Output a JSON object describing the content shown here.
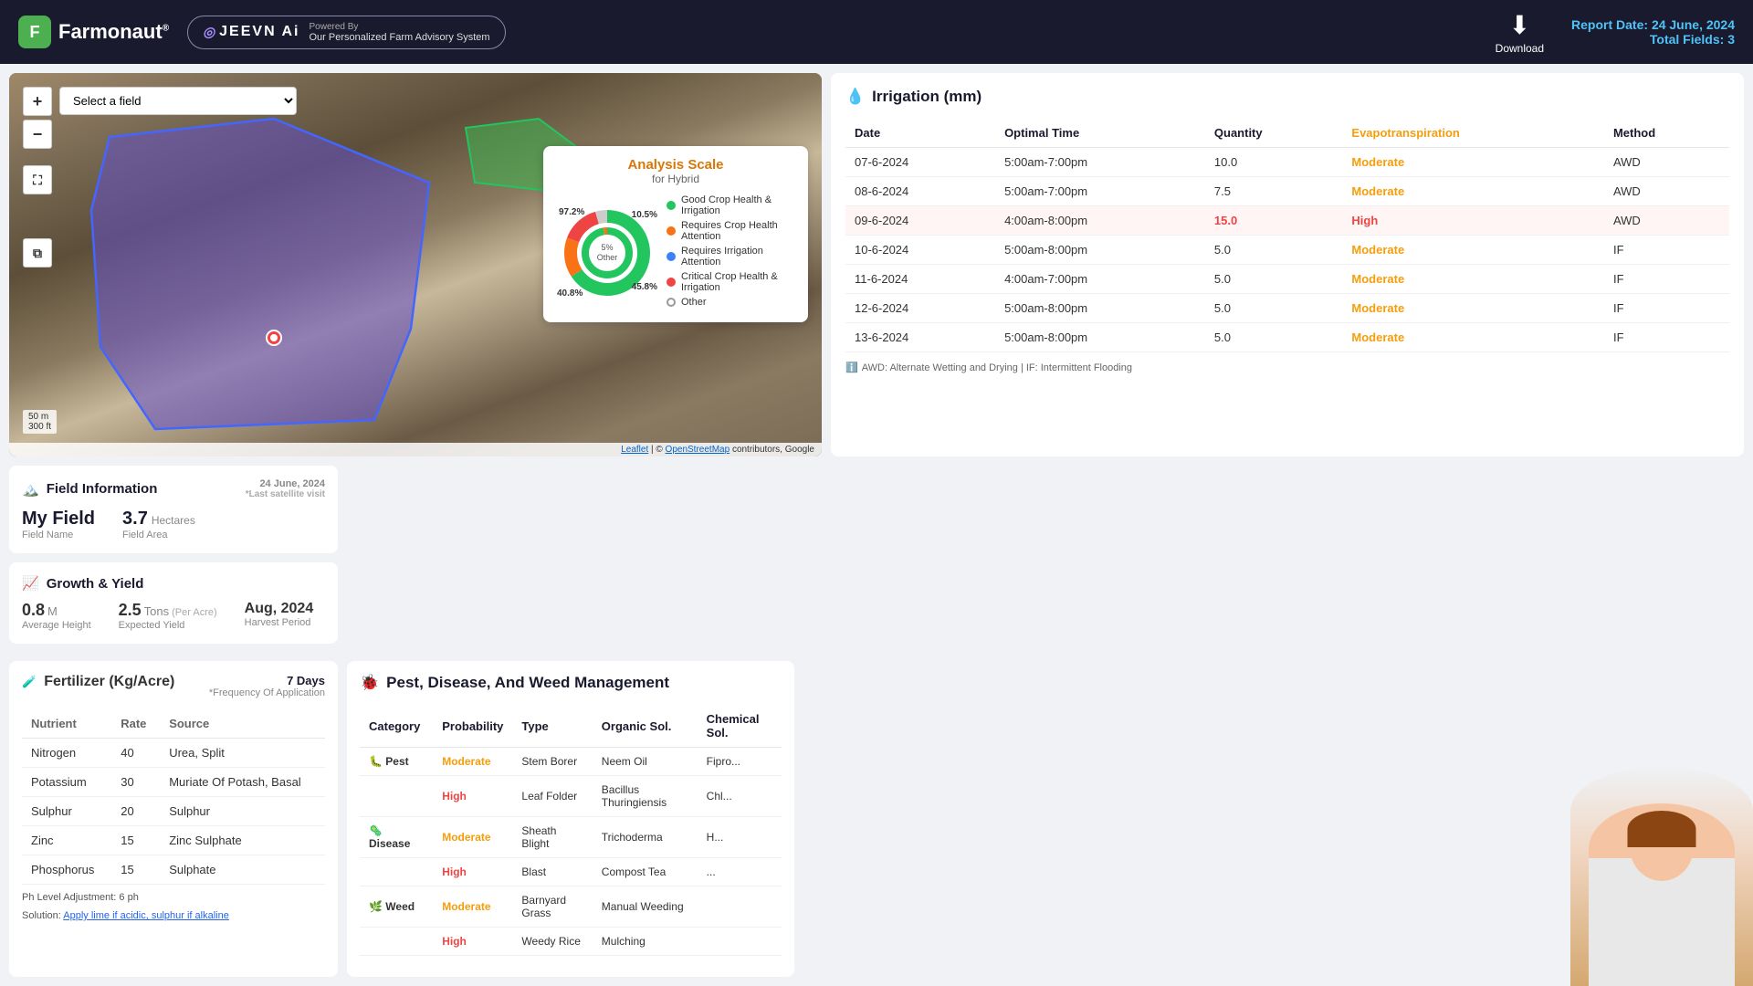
{
  "header": {
    "logo_text": "Farmonaut",
    "logo_reg": "®",
    "jeevn_label": "JEEVN Ai",
    "powered_by": "Powered By",
    "jeevn_subtitle": "Our Personalized Farm Advisory System",
    "download_label": "Download",
    "report_date_label": "Report Date:",
    "report_date_value": "24 June, 2024",
    "total_fields_label": "Total Fields:",
    "total_fields_value": "3"
  },
  "map": {
    "select_placeholder": "Select a field",
    "zoom_in": "+",
    "zoom_out": "−",
    "scale_m": "50 m",
    "scale_ft": "300 ft",
    "attribution": "Leaflet | © OpenStreetMap contributors, Google"
  },
  "analysis_scale": {
    "title": "Analysis Scale",
    "subtitle": "for Hybrid",
    "pct_97": "97.2%",
    "pct_10": "10.5%",
    "pct_45": "45.8%",
    "pct_40": "40.8%",
    "pct_5_label": "5%\nOther",
    "legend": [
      {
        "color": "#22c55e",
        "label": "Good Crop Health & Irrigation"
      },
      {
        "color": "#f97316",
        "label": "Requires Crop Health Attention"
      },
      {
        "color": "#3b82f6",
        "label": "Requires Irrigation Attention"
      },
      {
        "color": "#ef4444",
        "label": "Critical Crop Health & Irrigation"
      },
      {
        "color": "none",
        "label": "Other",
        "ring": true
      }
    ]
  },
  "irrigation": {
    "title": "Irrigation (mm)",
    "columns": [
      "Date",
      "Optimal Time",
      "Quantity",
      "Evapotranspiration",
      "Method"
    ],
    "rows": [
      {
        "date": "07-6-2024",
        "time": "5:00am-7:00pm",
        "qty": "10.0",
        "et": "Moderate",
        "method": "AWD",
        "highlight": false
      },
      {
        "date": "08-6-2024",
        "time": "5:00am-7:00pm",
        "qty": "7.5",
        "et": "Moderate",
        "method": "AWD",
        "highlight": false
      },
      {
        "date": "09-6-2024",
        "time": "4:00am-8:00pm",
        "qty": "15.0",
        "et": "High",
        "method": "AWD",
        "highlight": true
      },
      {
        "date": "10-6-2024",
        "time": "5:00am-8:00pm",
        "qty": "5.0",
        "et": "Moderate",
        "method": "IF",
        "highlight": false
      },
      {
        "date": "11-6-2024",
        "time": "4:00am-7:00pm",
        "qty": "5.0",
        "et": "Moderate",
        "method": "IF",
        "highlight": false
      },
      {
        "date": "12-6-2024",
        "time": "5:00am-8:00pm",
        "qty": "5.0",
        "et": "Moderate",
        "method": "IF",
        "highlight": false
      },
      {
        "date": "13-6-2024",
        "time": "5:00am-8:00pm",
        "qty": "5.0",
        "et": "Moderate",
        "method": "IF",
        "highlight": false
      }
    ],
    "note": "AWD: Alternate Wetting and Drying | IF: Intermittent Flooding"
  },
  "field_info": {
    "title": "Field Information",
    "date": "24 June, 2024",
    "date_sub": "*Last satellite visit",
    "field_name_label": "Field Name",
    "field_name": "My Field",
    "field_area_label": "Field Area",
    "field_area_val": "3.7",
    "field_area_unit": "Hectares"
  },
  "growth_yield": {
    "title": "Growth & Yield",
    "height_val": "0.8",
    "height_unit": "M",
    "height_label": "Average Height",
    "yield_val": "2.5",
    "yield_unit": "Tons",
    "yield_per": "(Per Acre)",
    "yield_label": "Expected Yield",
    "harvest_val": "Aug, 2024",
    "harvest_label": "Harvest Period"
  },
  "fertilizer": {
    "title": "Fertilizer (Kg/Acre)",
    "days": "7 Days",
    "freq": "*Frequency Of Application",
    "columns": [
      "Nutrient",
      "Rate",
      "Source"
    ],
    "rows": [
      {
        "nutrient": "Nitrogen",
        "rate": "40",
        "source": "Urea, Split"
      },
      {
        "nutrient": "Potassium",
        "rate": "30",
        "source": "Muriate Of Potash, Basal"
      },
      {
        "nutrient": "Sulphur",
        "rate": "20",
        "source": "Sulphur"
      },
      {
        "nutrient": "Zinc",
        "rate": "15",
        "source": "Zinc Sulphate"
      },
      {
        "nutrient": "Phosphorus",
        "rate": "15",
        "source": "Sulphate"
      }
    ],
    "ph_note": "Ph Level Adjustment: 6 ph",
    "solution_label": "Solution:",
    "solution_text": "Apply lime if acidic, sulphur if alkaline"
  },
  "pest": {
    "title": "Pest, Disease, And Weed Management",
    "columns": [
      "Category",
      "Probability",
      "Type",
      "Organic Sol.",
      "Chemical Sol."
    ],
    "rows": [
      {
        "category": "Pest",
        "icon": "🐛",
        "probability": "Moderate",
        "type": "Stem Borer",
        "organic": "Neem Oil",
        "chemical": "Fipro..."
      },
      {
        "category": "",
        "icon": "",
        "probability": "High",
        "type": "Leaf Folder",
        "organic": "Bacillus Thuringiensis",
        "chemical": "Chl..."
      },
      {
        "category": "Disease",
        "icon": "🦠",
        "probability": "Moderate",
        "type": "Sheath Blight",
        "organic": "Trichoderma",
        "chemical": "H..."
      },
      {
        "category": "",
        "icon": "",
        "probability": "High",
        "type": "Blast",
        "organic": "Compost Tea",
        "chemical": "..."
      },
      {
        "category": "Weed",
        "icon": "🌿",
        "probability": "Moderate",
        "type": "Barnyard Grass",
        "organic": "Manual Weeding",
        "chemical": ""
      },
      {
        "category": "",
        "icon": "",
        "probability": "High",
        "type": "Weedy Rice",
        "organic": "Mulching",
        "chemical": ""
      }
    ]
  }
}
